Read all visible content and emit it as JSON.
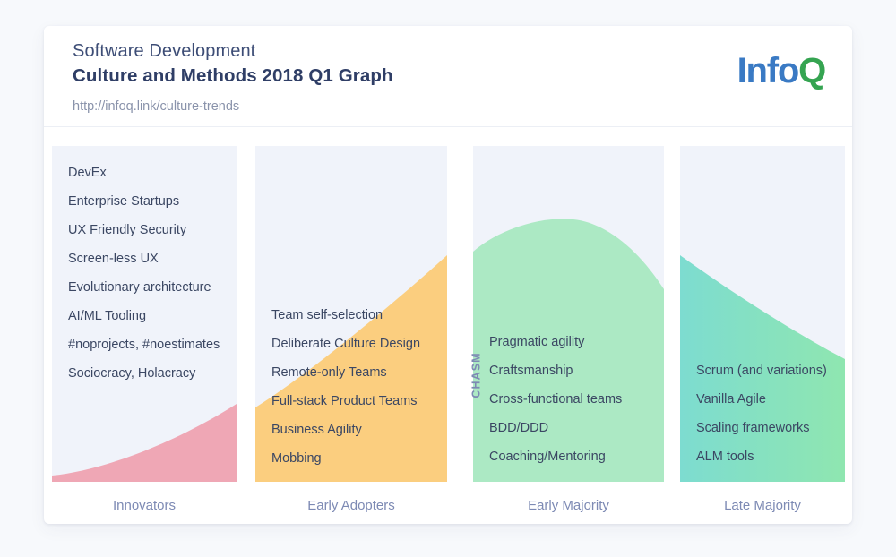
{
  "header": {
    "title_line1": "Software Development",
    "title_line2": "Culture and Methods 2018 Q1 Graph",
    "url": "http://infoq.link/culture-trends",
    "logo_info": "Info",
    "logo_q": "Q"
  },
  "chasm_label": "CHASM",
  "colors": {
    "panel_bg": "#f0f3fa",
    "innovators_fill": "#efa7b5",
    "early_adopters_fill": "#fbce7f",
    "early_majority_fill": "#ace9c4",
    "late_majority_fill_left": "#7ddcd0",
    "late_majority_fill_right": "#8fe6b0",
    "text": "#3b4763",
    "axis_text": "#7d8ab4",
    "logo_blue": "#3a7ac4",
    "logo_green": "#35a451"
  },
  "chart_data": {
    "type": "area",
    "title": "Culture and Methods 2018 Q1 Graph",
    "subtitle": "Software Development",
    "xlabel": "",
    "ylabel": "",
    "grid": false,
    "legend": "none",
    "annotations": [
      "CHASM"
    ],
    "categories": [
      "Innovators",
      "Early Adopters",
      "Early Majority",
      "Late Majority"
    ],
    "columns": [
      {
        "name": "Innovators",
        "fill": "#efa7b5",
        "curve": "rising-from-baseline",
        "items": [
          "DevEx",
          "Enterprise Startups",
          "UX Friendly Security",
          "Screen-less UX",
          "Evolutionary architecture",
          "AI/ML Tooling",
          "#noprojects, #noestimates",
          "Sociocracy, Holacracy"
        ]
      },
      {
        "name": "Early Adopters",
        "fill": "#fbce7f",
        "curve": "steep-rise-diagonal",
        "items": [
          "Team self-selection",
          "Deliberate Culture Design",
          "Remote-only Teams",
          "Full-stack Product Teams",
          "Business Agility",
          "Mobbing"
        ]
      },
      {
        "name": "Early Majority",
        "fill": "#ace9c4",
        "curve": "peak-dome",
        "items": [
          "Pragmatic agility",
          "Craftsmanship",
          "Cross-functional teams",
          "BDD/DDD",
          "Coaching/Mentoring"
        ]
      },
      {
        "name": "Late Majority",
        "fill": "#7ddcd0",
        "curve": "declining-diagonal",
        "items": [
          "Scrum (and variations)",
          "Vanilla Agile",
          "Scaling frameworks",
          "ALM tools"
        ]
      }
    ]
  }
}
